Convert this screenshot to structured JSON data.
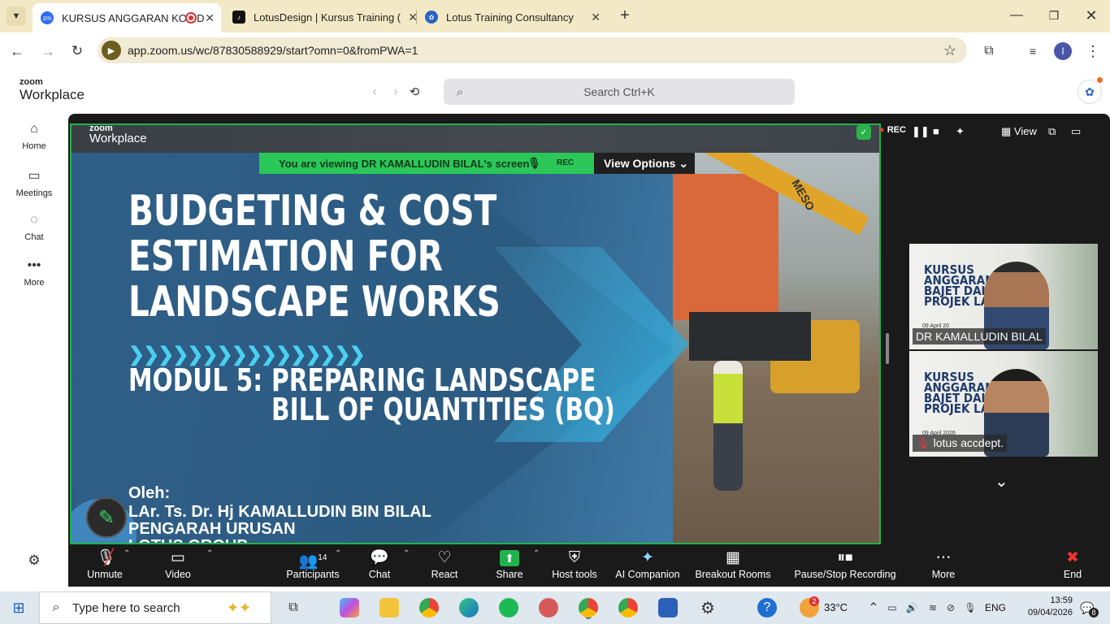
{
  "browser": {
    "tabs": [
      {
        "label": "KURSUS ANGGARAN KOS D",
        "favicon": "zm"
      },
      {
        "label": "LotusDesign | Kursus Training (",
        "favicon": "tiktok-icon"
      },
      {
        "label": "Lotus Training Consultancy",
        "favicon": "lotus-icon"
      }
    ],
    "url": "app.zoom.us/wc/87830588929/start?omn=0&fromPWA=1",
    "profile_initial": "I"
  },
  "zoom_header": {
    "logo_small": "zoom",
    "logo_big": "Workplace",
    "search_placeholder": "Search Ctrl+K"
  },
  "sidebar": {
    "items": [
      {
        "label": "Home"
      },
      {
        "label": "Meetings"
      },
      {
        "label": "Chat"
      },
      {
        "label": "More"
      }
    ]
  },
  "meeting": {
    "top_logo_small": "zoom",
    "top_logo_big": "Workplace",
    "viewing_banner": "You are viewing  DR KAMALLUDIN BILAL's screen",
    "viewing_rec": "REC",
    "view_options": "View Options",
    "rec_label": "REC",
    "view_label": "View"
  },
  "slide": {
    "title_lines": [
      "BUDGETING & COST",
      "ESTIMATION FOR",
      "LANDSCAPE WORKS"
    ],
    "chevrons": "❯❯❯❯❯❯❯❯❯❯❯❯❯❯❯❯",
    "module_prefix": "MODUL 5:",
    "module_lines": [
      "PREPARING LANDSCAPE",
      "BILL OF QUANTITIES (BQ)"
    ],
    "oleh": "Oleh:",
    "presenter": "LAr. Ts. Dr. Hj KAMALLUDIN BIN BILAL",
    "role": "PENGARAH URUSAN",
    "org": "LOTUS GROUP",
    "excavator_text": "MESO"
  },
  "gallery": [
    {
      "name": "DR KAMALLUDIN BILAL",
      "banner": "KURSUS ANGGARAN KOS & BAJET DALAM PROJEK LANDSKAP",
      "date": "09 April 20"
    },
    {
      "name": "lotus accdept.",
      "banner": "KURSUS ANGGARAN KOS & BAJET DALAM PROJEK LANDSKAP",
      "date": "09 April 2026",
      "muted": true
    }
  ],
  "controls": [
    {
      "label": "Unmute",
      "icon": "mic-off-icon"
    },
    {
      "label": "Video",
      "icon": "video-icon"
    },
    {
      "label": "Participants",
      "icon": "participants-icon",
      "count": "14"
    },
    {
      "label": "Chat",
      "icon": "chat-icon"
    },
    {
      "label": "React",
      "icon": "heart-icon"
    },
    {
      "label": "Share",
      "icon": "share-icon"
    },
    {
      "label": "Host tools",
      "icon": "shield-icon"
    },
    {
      "label": "AI Companion",
      "icon": "sparkle-icon"
    },
    {
      "label": "Breakout Rooms",
      "icon": "grid-icon"
    },
    {
      "label": "Pause/Stop Recording",
      "icon": "record-icon"
    },
    {
      "label": "More",
      "icon": "more-icon"
    },
    {
      "label": "End",
      "icon": "end-icon"
    }
  ],
  "taskbar": {
    "search": "Type here to search",
    "temp": "33°C",
    "lang": "ENG",
    "time": "13:59",
    "date": "09/04/2026",
    "notif": "8",
    "mail_badge": "2"
  },
  "colors": {
    "zoom_green": "#21b24b",
    "slide_blue": "#2e5f86",
    "accent_cyan": "#4ad0f0",
    "tab_bar": "#f4e9c6"
  }
}
